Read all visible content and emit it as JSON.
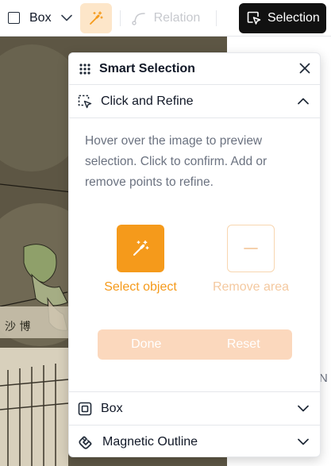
{
  "toolbar": {
    "box_label": "Box",
    "relation_label": "Relation",
    "selection_label": "Selection"
  },
  "background": {
    "edge_text": "N"
  },
  "panel": {
    "title": "Smart Selection",
    "sections": {
      "click_refine": "Click and Refine",
      "box": "Box",
      "magnetic": "Magnetic Outline"
    },
    "description": "Hover over the image to preview selection. Click to confirm. Add or remove points to refine.",
    "tools": {
      "select_label": "Select object",
      "remove_label": "Remove area"
    },
    "actions": {
      "done": "Done",
      "reset": "Reset"
    }
  },
  "colors": {
    "accent": "#f59a1b",
    "accent_light": "#fde6c9",
    "action_bar": "#fbd8bd",
    "selection_button": "#111111"
  }
}
